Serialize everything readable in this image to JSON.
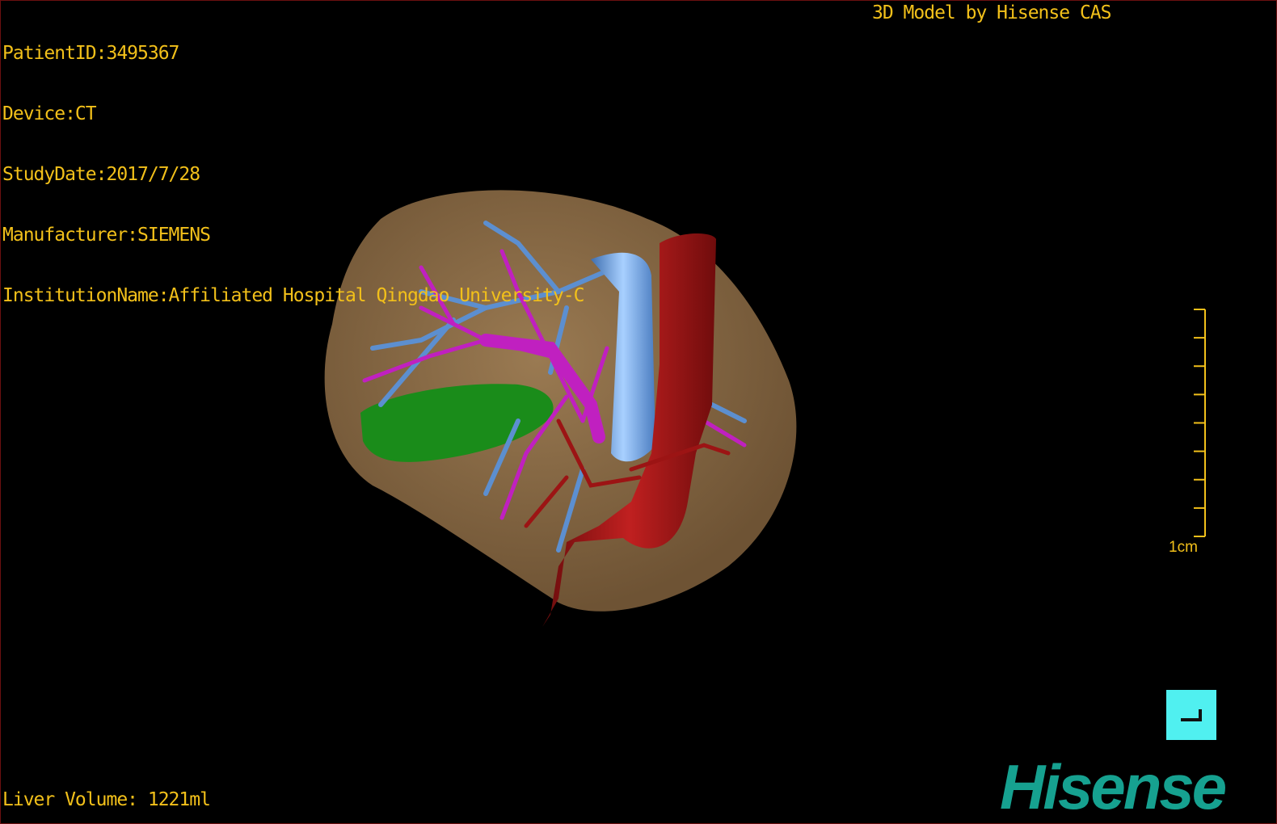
{
  "info": {
    "patient_id": "PatientID:3495367",
    "device": "Device:CT",
    "study_date": "StudyDate:2017/7/28",
    "manufacturer": "Manufacturer:SIEMENS",
    "institution": "InstitutionName:Affiliated Hospital Qingdao University-C"
  },
  "brand_text": "3D Model by Hisense CAS",
  "liver_volume": "Liver Volume: 1221ml",
  "scale": {
    "label": "1cm",
    "ticks": 9
  },
  "logo": "Hisense",
  "colors": {
    "overlay_text": "#f2c01a",
    "liver": "#8a6a44",
    "gallbladder": "#1a8c1a",
    "portal_vein": "#c020c0",
    "hepatic_vein": "#5c8fd0",
    "artery": "#9c1414",
    "button": "#50f0f0",
    "logo": "#16a190"
  },
  "model": {
    "structures": [
      "liver",
      "gallbladder",
      "portal-vein",
      "hepatic-vein",
      "inferior-vena-cava",
      "aorta"
    ]
  }
}
